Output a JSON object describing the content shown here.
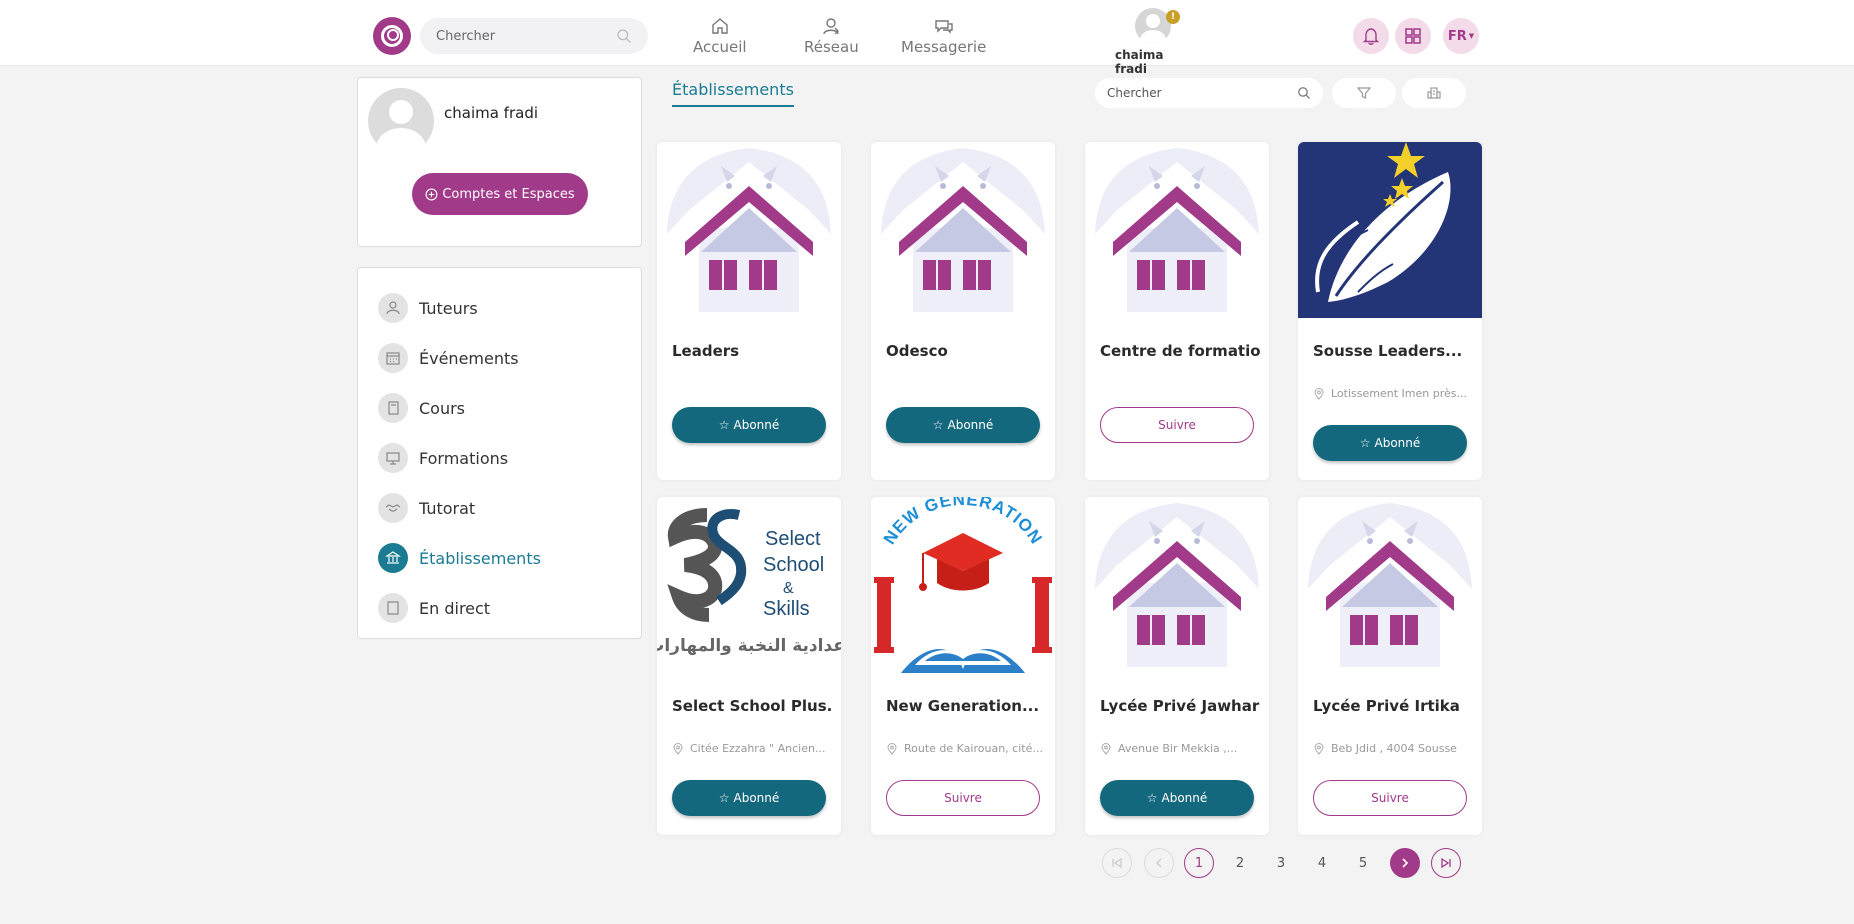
{
  "header": {
    "search_placeholder": "Chercher",
    "nav": [
      {
        "label": "Accueil",
        "icon": "home-icon"
      },
      {
        "label": "Réseau",
        "icon": "network-icon"
      },
      {
        "label": "Messagerie",
        "icon": "messages-icon"
      }
    ],
    "user_name": "chaima fradi",
    "user_badge": "!",
    "language": "FR"
  },
  "profile": {
    "name": "chaima fradi",
    "accounts_button": "Comptes et Espaces"
  },
  "sidebar": {
    "items": [
      {
        "label": "Tuteurs",
        "icon": "tutor-icon",
        "active": false
      },
      {
        "label": "Événements",
        "icon": "calendar-icon",
        "active": false
      },
      {
        "label": "Cours",
        "icon": "course-icon",
        "active": false
      },
      {
        "label": "Formations",
        "icon": "training-icon",
        "active": false
      },
      {
        "label": "Tutorat",
        "icon": "handshake-icon",
        "active": false
      },
      {
        "label": "Établissements",
        "icon": "institution-icon",
        "active": true
      },
      {
        "label": "En direct",
        "icon": "live-icon",
        "active": false
      }
    ]
  },
  "main": {
    "tab_label": "Établissements",
    "search_placeholder": "Chercher",
    "cards": [
      {
        "title": "Leaders",
        "location": "",
        "button": "Abonné",
        "subscribed": true,
        "image": "house-placeholder"
      },
      {
        "title": "Odesco",
        "location": "",
        "button": "Abonné",
        "subscribed": true,
        "image": "house-placeholder"
      },
      {
        "title": "Centre de formation",
        "location": "",
        "button": "Suivre",
        "subscribed": false,
        "image": "house-placeholder"
      },
      {
        "title": "Sousse Leaders...",
        "location": "Lotissement Imen près...",
        "button": "Abonné",
        "subscribed": true,
        "image": "feather-stars-logo"
      },
      {
        "title": "Select School Plus...",
        "location": "Citée Ezzahra \" Ancien...",
        "button": "Abonné",
        "subscribed": true,
        "image": "select-school-logo"
      },
      {
        "title": "New Generation...",
        "location": "Route de Kairouan, cité...",
        "button": "Suivre",
        "subscribed": false,
        "image": "new-generation-logo"
      },
      {
        "title": "Lycée Privé Jawhara",
        "location": "Avenue Bir Mekkia ,...",
        "button": "Abonné",
        "subscribed": true,
        "image": "house-placeholder"
      },
      {
        "title": "Lycée Privé Irtika",
        "location": "Beb Jdid , 4004 Sousse",
        "button": "Suivre",
        "subscribed": false,
        "image": "house-placeholder"
      }
    ],
    "logo_text": {
      "select_school": [
        "Select",
        "School",
        "&",
        "Skills"
      ],
      "select_school_arabic": "اعدادية النخبة والمهارات",
      "new_generation": "NEW GENERATION"
    }
  },
  "pagination": {
    "pages": [
      "1",
      "2",
      "3",
      "4",
      "5"
    ],
    "current": "1"
  },
  "colors": {
    "accent": "#a23a8a",
    "teal": "#1a7b93",
    "button_teal": "#14687d"
  }
}
